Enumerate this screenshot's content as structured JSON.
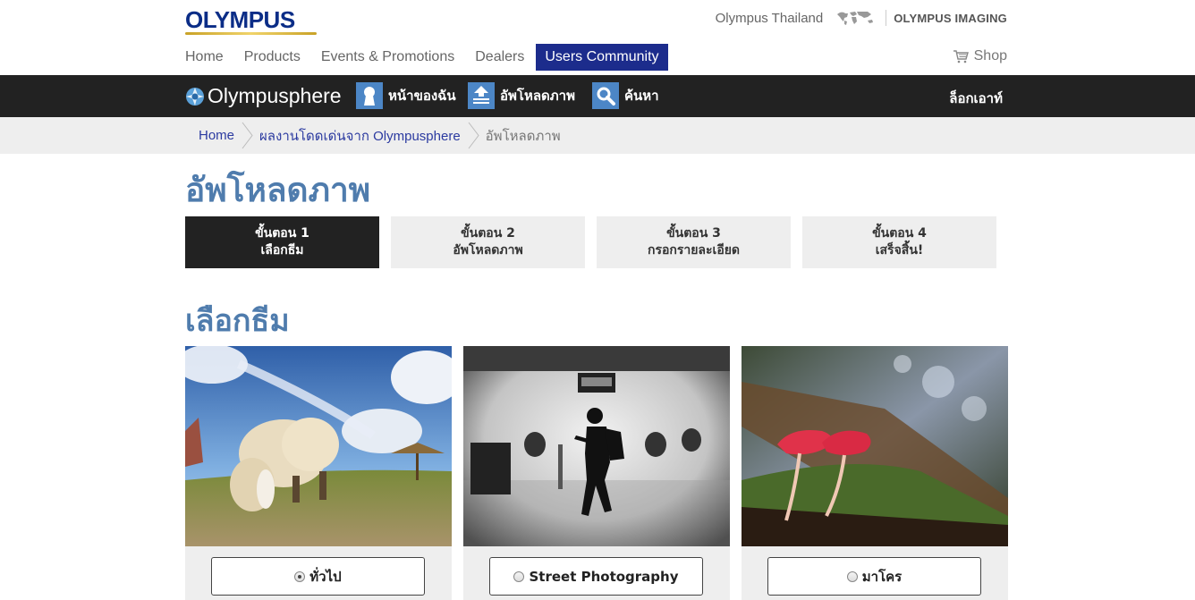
{
  "brand": {
    "logo": "OLYMPUS",
    "region": "Olympus Thailand",
    "imaging": "OLYMPUS IMAGING"
  },
  "mainnav": {
    "items": [
      "Home",
      "Products",
      "Events & Promotions",
      "Dealers"
    ],
    "active": "Users Community",
    "shop": "Shop"
  },
  "community": {
    "logo": "Olympusphere",
    "my_page": "หน้าของฉัน",
    "upload": "อัพโหลดภาพ",
    "search": "ค้นหา",
    "logout": "ล็อกเอาท์"
  },
  "breadcrumb": [
    "Home",
    "ผลงานโดดเด่นจาก Olympusphere",
    "อัพโหลดภาพ"
  ],
  "page": {
    "title": "อัพโหลดภาพ",
    "subtitle": "เลือกธีม"
  },
  "steps": [
    {
      "num": "ขั้นตอน 1",
      "label": "เลือกธีม",
      "active": true
    },
    {
      "num": "ขั้นตอน 2",
      "label": "อัพโหลดภาพ",
      "active": false
    },
    {
      "num": "ขั้นตอน 3",
      "label": "กรอกรายละเอียด",
      "active": false
    },
    {
      "num": "ขั้นตอน 4",
      "label": "เสร็จสิ้น!",
      "active": false
    }
  ],
  "themes": [
    {
      "label": "ทั่วไป",
      "selected": true
    },
    {
      "label": "Street Photography",
      "selected": false
    },
    {
      "label": "มาโคร",
      "selected": false
    }
  ],
  "colors": {
    "brand_blue": "#1c2c8c",
    "title_blue": "#4f7cad",
    "icon_blue": "#4c86c6",
    "dark": "#222222"
  }
}
